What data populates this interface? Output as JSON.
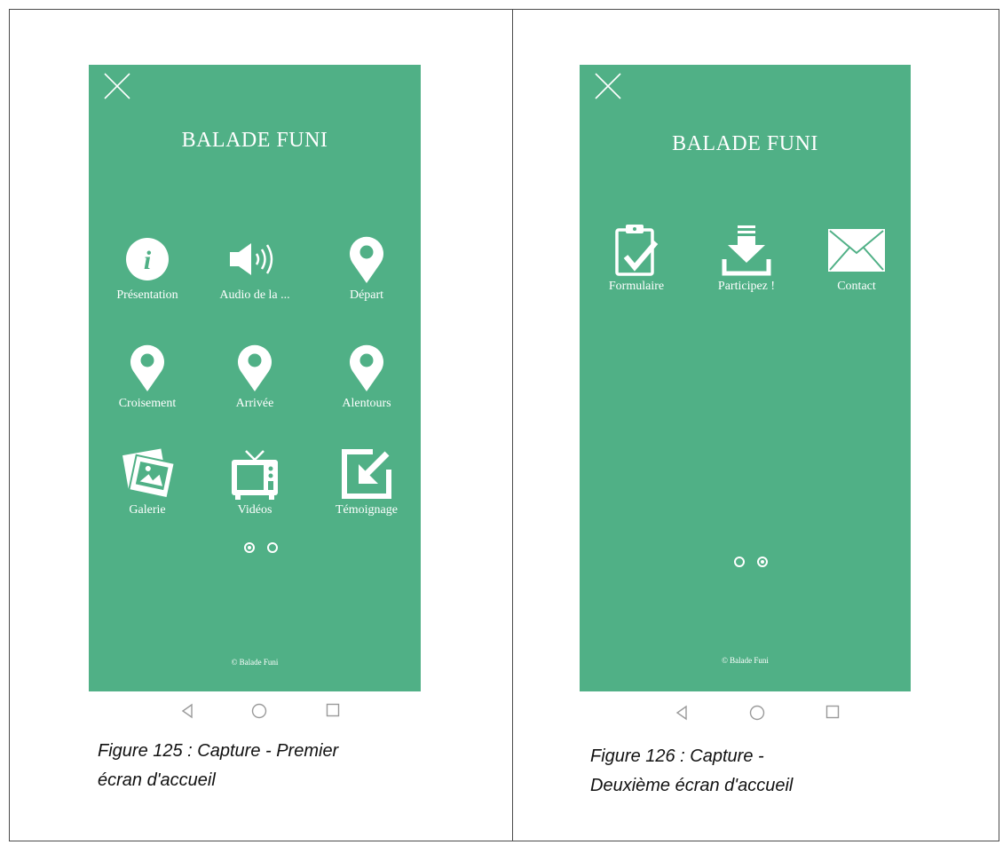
{
  "figures": [
    {
      "screen": {
        "title": "BALADE FUNI",
        "tiles": [
          {
            "label": "Présentation",
            "icon": "info-icon"
          },
          {
            "label": "Audio de la ...",
            "icon": "speaker-icon"
          },
          {
            "label": "Départ",
            "icon": "map-pin-icon"
          },
          {
            "label": "Croisement",
            "icon": "map-pin-icon"
          },
          {
            "label": "Arrivée",
            "icon": "map-pin-icon"
          },
          {
            "label": "Alentours",
            "icon": "map-pin-icon"
          },
          {
            "label": "Galerie",
            "icon": "photos-icon"
          },
          {
            "label": "Vidéos",
            "icon": "tv-icon"
          },
          {
            "label": "Témoignage",
            "icon": "edit-arrow-icon"
          }
        ],
        "pager": {
          "pages": 2,
          "active": 1
        },
        "copyright": "© Balade Funi"
      },
      "caption_lines": [
        "Figure 125 : Capture - Premier",
        "écran d'accueil"
      ]
    },
    {
      "screen": {
        "title": "BALADE FUNI",
        "tiles": [
          {
            "label": "Formulaire",
            "icon": "clipboard-check-icon"
          },
          {
            "label": "Participez !",
            "icon": "download-icon"
          },
          {
            "label": "Contact",
            "icon": "envelope-icon"
          }
        ],
        "pager": {
          "pages": 2,
          "active": 2
        },
        "copyright": "© Balade Funi"
      },
      "caption_lines": [
        "Figure 126 : Capture -",
        "Deuxième écran d'accueil"
      ]
    }
  ],
  "colors": {
    "screen_bg": "#50b086",
    "foreground": "#ffffff",
    "nav_icons": "#9a9a9a"
  }
}
